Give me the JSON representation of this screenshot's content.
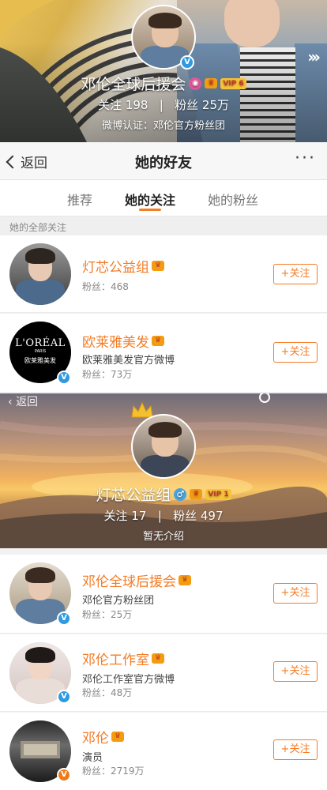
{
  "profile": {
    "name": "邓伦全球后援会",
    "vip_level": "VIP 6",
    "follow_label": "关注",
    "follow_count": "198",
    "separator": "|",
    "fans_label": "粉丝",
    "fans_count": "25万",
    "certification": "微博认证：邓伦官方粉丝团",
    "verify_mark": "V"
  },
  "nav": {
    "back_label": "返回",
    "title": "她的好友",
    "more_label": "···"
  },
  "tabs": [
    {
      "label": "推荐",
      "active": false
    },
    {
      "label": "她的关注",
      "active": true
    },
    {
      "label": "她的粉丝",
      "active": false
    }
  ],
  "section_header": "她的全部关注",
  "follow_button_label": "+关注",
  "list": [
    {
      "name": "灯芯公益组",
      "desc": "",
      "fans": "粉丝：468",
      "verify": ""
    },
    {
      "name": "欧莱雅美发",
      "desc": "欧莱雅美发官方微博",
      "fans": "粉丝：73万",
      "verify": "V"
    },
    {
      "name": "邓伦全球后援会",
      "desc": "邓伦官方粉丝团",
      "fans": "粉丝：25万",
      "verify": "V"
    },
    {
      "name": "邓伦工作室",
      "desc": "邓伦工作室官方微博",
      "fans": "粉丝：48万",
      "verify": "V"
    },
    {
      "name": "邓伦",
      "desc": "演员",
      "fans": "粉丝：2719万",
      "verify": "V"
    }
  ],
  "loreal": {
    "wordmark": "L'ORÉAL",
    "sub": "PARIS",
    "cn": "欧莱雅美发"
  },
  "overlay_profile": {
    "back_label": "返回",
    "name": "灯芯公益组",
    "gender": "♂",
    "vip_level": "VIP 1",
    "follow_label": "关注",
    "follow_count": "17",
    "separator": "|",
    "fans_label": "粉丝",
    "fans_count": "497",
    "intro": "暂无介绍"
  },
  "colors": {
    "accent": "#f47c26",
    "verify_blue": "#2f9ae0",
    "verify_orange": "#f07a1a"
  }
}
